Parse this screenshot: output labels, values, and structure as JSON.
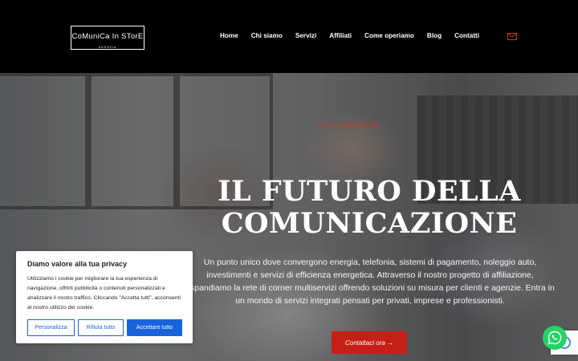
{
  "header": {
    "logo_main": "CoMuniCa In STorE",
    "logo_sub": "AGENZIA",
    "nav": [
      "Home",
      "Chi siamo",
      "Servizi",
      "Affiliati",
      "Come operiamo",
      "Blog",
      "Contatti"
    ],
    "mail_icon": "mail-icon"
  },
  "hero": {
    "eyebrow": "I vostri professionisti",
    "title_line1": "IL FUTURO DELLA",
    "title_line2": "COMUNICAZIONE",
    "text": "Un punto unico dove convergono energia, telefonia, sistemi di pagamento, noleggio auto, investimenti e servizi di efficienza energetica. Attraverso il nostro progetto di affiliazione, espandiamo la rete di corner multiservizi offrendo soluzioni su misura per clienti e agenzie. Entra in un mondo di servizi integrati pensati per privati, imprese e professionisti.",
    "cta": "Contattaci ora →"
  },
  "cookie": {
    "title": "Diamo valore alla tua privacy",
    "text": "Utilizziamo i cookie per migliorare la tua esperienza di navigazione, offrirti pubblicità o contenuti personalizzati e analizzare il nostro traffico. Cliccando \"Accetta tutti\", acconsenti al nostro utilizzo dei cookie.",
    "customize": "Personalizza",
    "reject": "Rifiuta tutto",
    "accept": "Accettare tutto"
  },
  "colors": {
    "accent": "#c51f17",
    "cookie_button": "#1863dc",
    "whatsapp": "#25d366"
  }
}
